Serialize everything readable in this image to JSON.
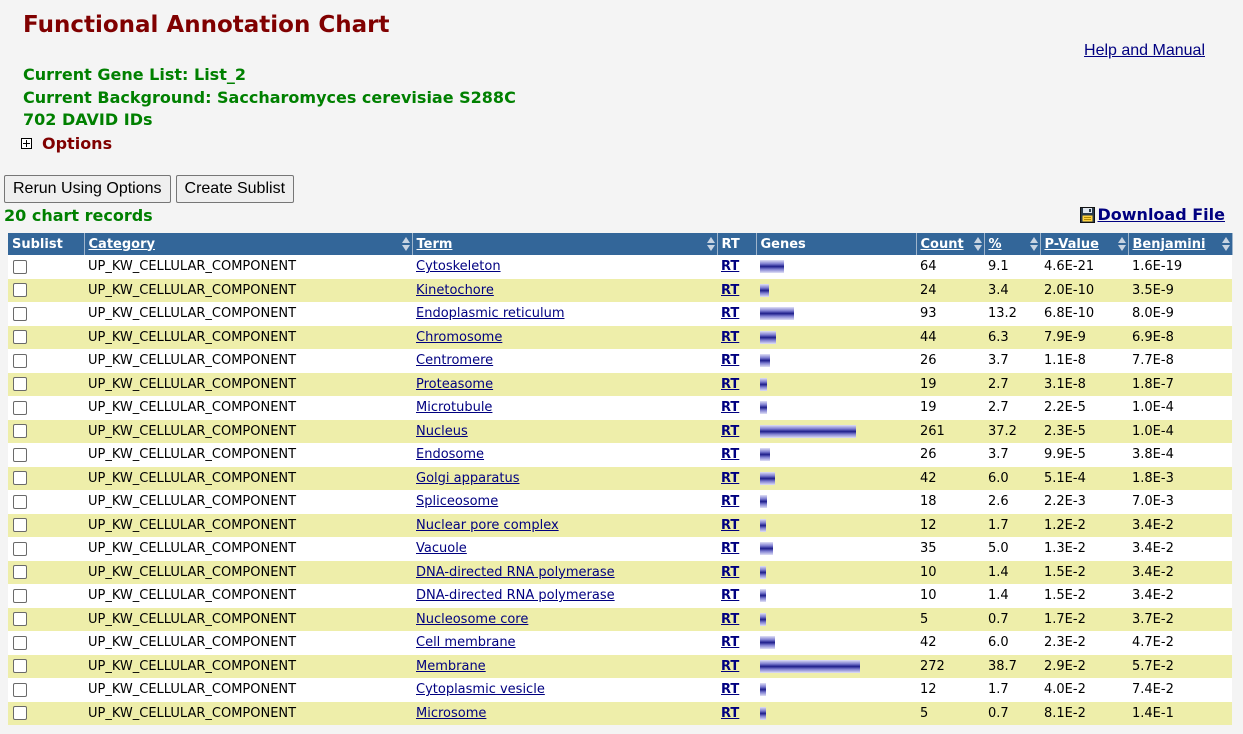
{
  "page": {
    "title": "Functional Annotation Chart",
    "help_link": "Help and Manual",
    "gene_list": "Current Gene List: List_2",
    "background": "Current Background: Saccharomyces cerevisiae S288C",
    "david_ids": "702 DAVID IDs",
    "options_label": "Options",
    "rerun_button": "Rerun Using Options",
    "sublist_button": "Create Sublist",
    "record_count": "20 chart records",
    "download_label": "Download File"
  },
  "table": {
    "headers": {
      "sublist": "Sublist",
      "category": "Category",
      "term": "Term",
      "rt": "RT",
      "genes": "Genes",
      "count": "Count",
      "percent": "%",
      "pvalue": "P-Value",
      "benjamini": "Benjamini"
    },
    "rows": [
      {
        "category": "UP_KW_CELLULAR_COMPONENT",
        "term": "Cytoskeleton",
        "rt": "RT",
        "count": "64",
        "percent": "9.1",
        "pvalue": "4.6E-21",
        "benjamini": "1.6E-19"
      },
      {
        "category": "UP_KW_CELLULAR_COMPONENT",
        "term": "Kinetochore",
        "rt": "RT",
        "count": "24",
        "percent": "3.4",
        "pvalue": "2.0E-10",
        "benjamini": "3.5E-9"
      },
      {
        "category": "UP_KW_CELLULAR_COMPONENT",
        "term": "Endoplasmic reticulum",
        "rt": "RT",
        "count": "93",
        "percent": "13.2",
        "pvalue": "6.8E-10",
        "benjamini": "8.0E-9"
      },
      {
        "category": "UP_KW_CELLULAR_COMPONENT",
        "term": "Chromosome",
        "rt": "RT",
        "count": "44",
        "percent": "6.3",
        "pvalue": "7.9E-9",
        "benjamini": "6.9E-8"
      },
      {
        "category": "UP_KW_CELLULAR_COMPONENT",
        "term": "Centromere",
        "rt": "RT",
        "count": "26",
        "percent": "3.7",
        "pvalue": "1.1E-8",
        "benjamini": "7.7E-8"
      },
      {
        "category": "UP_KW_CELLULAR_COMPONENT",
        "term": "Proteasome",
        "rt": "RT",
        "count": "19",
        "percent": "2.7",
        "pvalue": "3.1E-8",
        "benjamini": "1.8E-7"
      },
      {
        "category": "UP_KW_CELLULAR_COMPONENT",
        "term": "Microtubule",
        "rt": "RT",
        "count": "19",
        "percent": "2.7",
        "pvalue": "2.2E-5",
        "benjamini": "1.0E-4"
      },
      {
        "category": "UP_KW_CELLULAR_COMPONENT",
        "term": "Nucleus",
        "rt": "RT",
        "count": "261",
        "percent": "37.2",
        "pvalue": "2.3E-5",
        "benjamini": "1.0E-4"
      },
      {
        "category": "UP_KW_CELLULAR_COMPONENT",
        "term": "Endosome",
        "rt": "RT",
        "count": "26",
        "percent": "3.7",
        "pvalue": "9.9E-5",
        "benjamini": "3.8E-4"
      },
      {
        "category": "UP_KW_CELLULAR_COMPONENT",
        "term": "Golgi apparatus",
        "rt": "RT",
        "count": "42",
        "percent": "6.0",
        "pvalue": "5.1E-4",
        "benjamini": "1.8E-3"
      },
      {
        "category": "UP_KW_CELLULAR_COMPONENT",
        "term": "Spliceosome",
        "rt": "RT",
        "count": "18",
        "percent": "2.6",
        "pvalue": "2.2E-3",
        "benjamini": "7.0E-3"
      },
      {
        "category": "UP_KW_CELLULAR_COMPONENT",
        "term": "Nuclear pore complex",
        "rt": "RT",
        "count": "12",
        "percent": "1.7",
        "pvalue": "1.2E-2",
        "benjamini": "3.4E-2"
      },
      {
        "category": "UP_KW_CELLULAR_COMPONENT",
        "term": "Vacuole",
        "rt": "RT",
        "count": "35",
        "percent": "5.0",
        "pvalue": "1.3E-2",
        "benjamini": "3.4E-2"
      },
      {
        "category": "UP_KW_CELLULAR_COMPONENT",
        "term": "DNA-directed RNA polymerase",
        "rt": "RT",
        "count": "10",
        "percent": "1.4",
        "pvalue": "1.5E-2",
        "benjamini": "3.4E-2"
      },
      {
        "category": "UP_KW_CELLULAR_COMPONENT",
        "term": "DNA-directed RNA polymerase",
        "rt": "RT",
        "count": "10",
        "percent": "1.4",
        "pvalue": "1.5E-2",
        "benjamini": "3.4E-2"
      },
      {
        "category": "UP_KW_CELLULAR_COMPONENT",
        "term": "Nucleosome core",
        "rt": "RT",
        "count": "5",
        "percent": "0.7",
        "pvalue": "1.7E-2",
        "benjamini": "3.7E-2"
      },
      {
        "category": "UP_KW_CELLULAR_COMPONENT",
        "term": "Cell membrane",
        "rt": "RT",
        "count": "42",
        "percent": "6.0",
        "pvalue": "2.3E-2",
        "benjamini": "4.7E-2"
      },
      {
        "category": "UP_KW_CELLULAR_COMPONENT",
        "term": "Membrane",
        "rt": "RT",
        "count": "272",
        "percent": "38.7",
        "pvalue": "2.9E-2",
        "benjamini": "5.7E-2"
      },
      {
        "category": "UP_KW_CELLULAR_COMPONENT",
        "term": "Cytoplasmic vesicle",
        "rt": "RT",
        "count": "12",
        "percent": "1.7",
        "pvalue": "4.0E-2",
        "benjamini": "7.4E-2"
      },
      {
        "category": "UP_KW_CELLULAR_COMPONENT",
        "term": "Microsome",
        "rt": "RT",
        "count": "5",
        "percent": "0.7",
        "pvalue": "8.1E-2",
        "benjamini": "1.4E-1"
      }
    ]
  },
  "colors": {
    "title": "#800000",
    "info_text": "#008000",
    "header_bg": "#336699",
    "row_alt": "#eeeeaa",
    "link": "#000080"
  }
}
